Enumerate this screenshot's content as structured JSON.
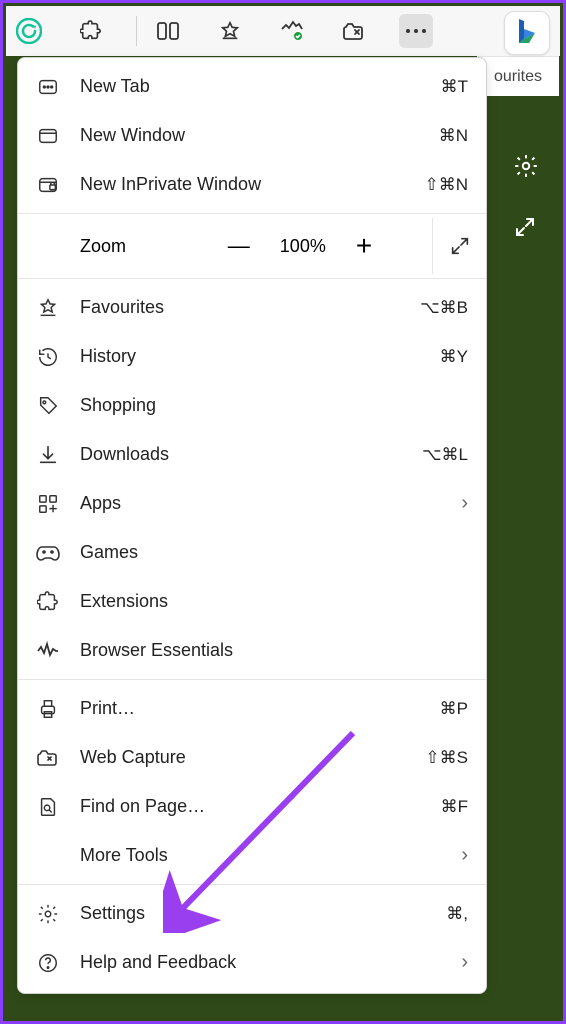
{
  "toolbar": {
    "more_icon": "…",
    "favourites_tab": "ourites"
  },
  "menu": {
    "new_tab": "New Tab",
    "new_tab_sc": "⌘T",
    "new_window": "New Window",
    "new_window_sc": "⌘N",
    "new_inprivate": "New InPrivate Window",
    "new_inprivate_sc": "⇧⌘N",
    "zoom_label": "Zoom",
    "zoom_pct": "100%",
    "favourites": "Favourites",
    "favourites_sc": "⌥⌘B",
    "history": "History",
    "history_sc": "⌘Y",
    "shopping": "Shopping",
    "downloads": "Downloads",
    "downloads_sc": "⌥⌘L",
    "apps": "Apps",
    "games": "Games",
    "extensions": "Extensions",
    "browser_essentials": "Browser Essentials",
    "print": "Print…",
    "print_sc": "⌘P",
    "web_capture": "Web Capture",
    "web_capture_sc": "⇧⌘S",
    "find": "Find on Page…",
    "find_sc": "⌘F",
    "more_tools": "More Tools",
    "settings": "Settings",
    "settings_sc": "⌘,",
    "help": "Help and Feedback"
  }
}
